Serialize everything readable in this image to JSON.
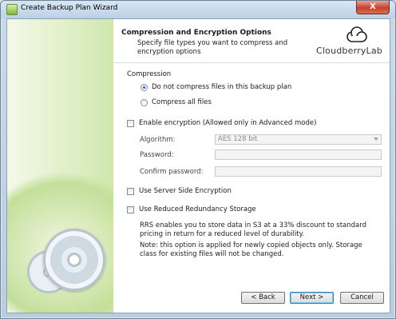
{
  "window": {
    "title": "Create Backup Plan Wizard",
    "close_glyph": "X"
  },
  "header": {
    "title": "Compression and Encryption Options",
    "description": "Specify file types you want to compress and encryption options",
    "logo_text": "CloudberryLab"
  },
  "compression": {
    "group_label": "Compression",
    "option_none": "Do not compress files in this backup plan",
    "option_all": "Compress all files",
    "selected": "option_none"
  },
  "encryption": {
    "enable_label": "Enable encryption (Allowed only in Advanced mode)",
    "checked": false,
    "algorithm_label": "Algorithm:",
    "algorithm_value": "AES 128 bit",
    "password_label": "Password:",
    "confirm_label": "Confirm password:"
  },
  "sse": {
    "label": "Use Server Side Encryption",
    "checked": false
  },
  "rrs": {
    "label": "Use Reduced Redundancy Storage",
    "checked": false,
    "info": "RRS enables you to store data in S3 at a 33% discount to standard pricing in return for a reduced level of durability.",
    "note": "Note: this option is applied for newly copied objects only. Storage class for existing files will not be changed."
  },
  "footer": {
    "back": "< Back",
    "next": "Next >",
    "cancel": "Cancel"
  }
}
